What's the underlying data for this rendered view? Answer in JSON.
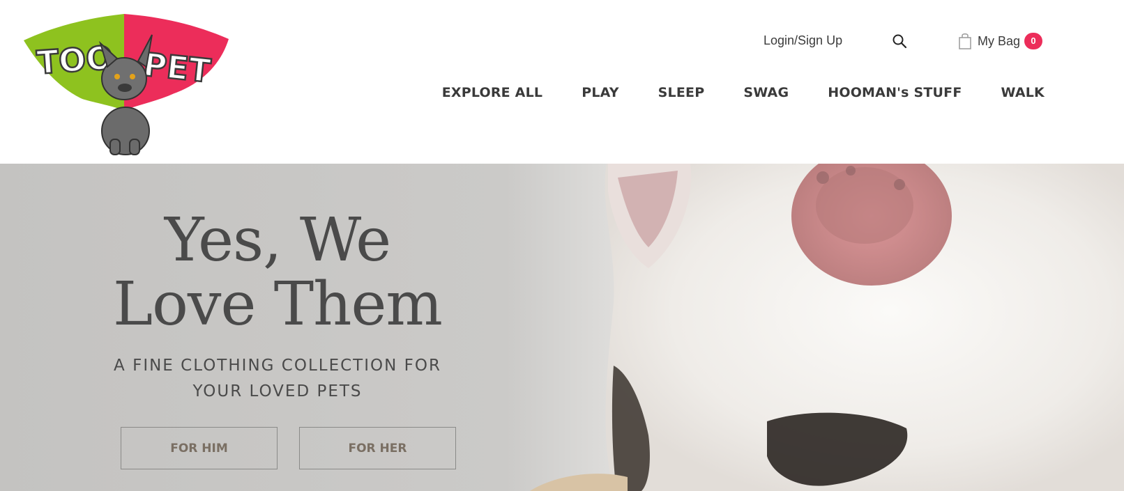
{
  "header": {
    "logo": {
      "text": "TOONPET",
      "colors": {
        "left": "#8ec21f",
        "right": "#ec2d5a"
      }
    },
    "login_label": "Login/Sign Up",
    "search_icon": "search-icon",
    "bag": {
      "label": "My Bag",
      "count": "0",
      "icon": "shopping-bag-icon",
      "badge_color": "#ec2d5a"
    }
  },
  "nav": {
    "items": [
      {
        "label": "EXPLORE ALL"
      },
      {
        "label": "PLAY"
      },
      {
        "label": "SLEEP"
      },
      {
        "label": "SWAG"
      },
      {
        "label": "HOOMAN's STUFF"
      },
      {
        "label": "WALK"
      }
    ]
  },
  "hero": {
    "title_line1": "Yes, We",
    "title_line2": "Love Them",
    "subtitle_line1": "A FINE CLOTHING COLLECTION FOR",
    "subtitle_line2": "YOUR LOVED PETS",
    "buttons": [
      {
        "label": "FOR HIM"
      },
      {
        "label": "FOR HER"
      }
    ]
  }
}
